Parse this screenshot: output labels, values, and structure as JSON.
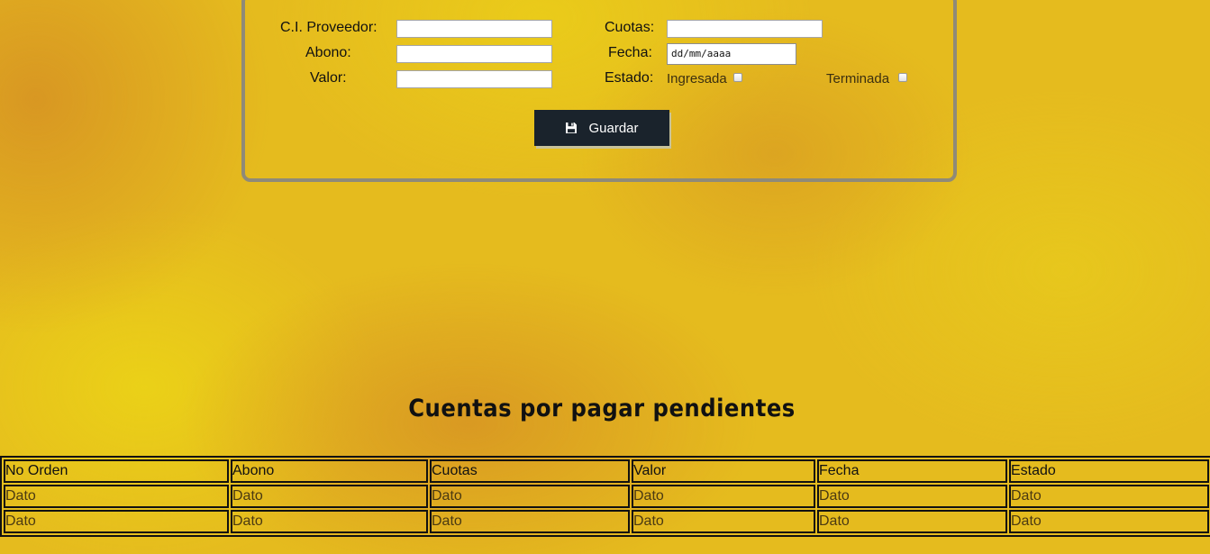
{
  "form": {
    "ci_proveedor_label": "C.I. Proveedor:",
    "abono_label": "Abono:",
    "valor_label": "Valor:",
    "cuotas_label": "Cuotas:",
    "fecha_label": "Fecha:",
    "fecha_placeholder": "dd/mm/aaaa",
    "estado_label": "Estado:",
    "estado_options": [
      "Ingresada",
      "Terminada"
    ],
    "save_label": "Guardar",
    "save_icon": "floppy-disk-icon"
  },
  "table": {
    "title": "Cuentas por pagar pendientes",
    "columns": [
      "No Orden",
      "Abono",
      "Cuotas",
      "Valor",
      "Fecha",
      "Estado"
    ],
    "rows": [
      [
        "Dato",
        "Dato",
        "Dato",
        "Dato",
        "Dato",
        "Dato"
      ],
      [
        "Dato",
        "Dato",
        "Dato",
        "Dato",
        "Dato",
        "Dato"
      ]
    ]
  },
  "colors": {
    "background": "#e5bb1e",
    "button_bg": "#1a232c",
    "panel_border": "#8f8a78"
  }
}
